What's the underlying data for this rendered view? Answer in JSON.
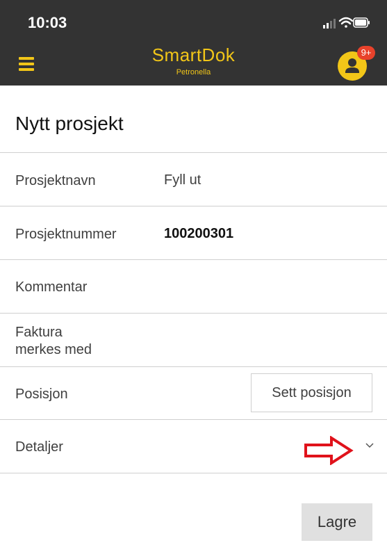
{
  "status_bar": {
    "time": "10:03"
  },
  "header": {
    "app_name": "SmartDok",
    "company": "Petronella",
    "notification_count": "9+",
    "accent_color": "#f2c618",
    "background_color": "#333333",
    "badge_color": "#e8422b"
  },
  "icons": [
    "signal-icon",
    "wifi-icon",
    "battery-icon",
    "menu-icon",
    "user-icon",
    "chevron-down-icon",
    "arrow-right-icon"
  ],
  "page": {
    "title": "Nytt prosjekt"
  },
  "form": {
    "project_name": {
      "label": "Prosjektnavn",
      "placeholder": "Fyll ut"
    },
    "project_number": {
      "label": "Prosjektnummer",
      "value": "100200301"
    },
    "comment": {
      "label": "Kommentar"
    },
    "invoice_marking": {
      "label_line1": "Faktura",
      "label_line2": "merkes med"
    },
    "position": {
      "label": "Posisjon",
      "button_label": "Sett posisjon"
    },
    "details": {
      "label": "Detaljer"
    }
  },
  "actions": {
    "save_label": "Lagre"
  }
}
